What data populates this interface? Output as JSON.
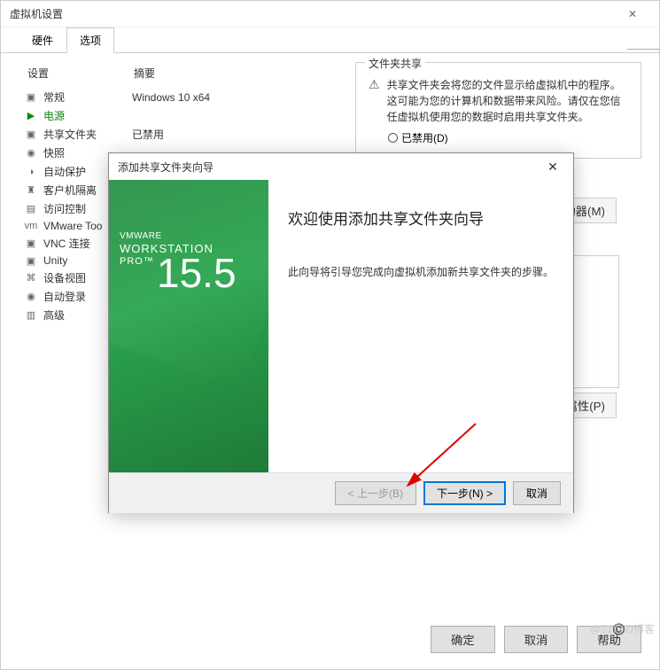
{
  "mainWindow": {
    "title": "虚拟机设置",
    "tabs": {
      "hardware": "硬件",
      "options": "选项"
    },
    "headers": {
      "setting": "设置",
      "summary": "摘要"
    },
    "rows": [
      {
        "icon": "▣",
        "label": "常规",
        "value": "Windows 10 x64"
      },
      {
        "icon": "▶",
        "label": "电源",
        "value": "",
        "green": true
      },
      {
        "icon": "▣",
        "label": "共享文件夹",
        "value": "已禁用"
      },
      {
        "icon": "◉",
        "label": "快照",
        "value": ""
      },
      {
        "icon": "◑",
        "label": "自动保护",
        "value": ""
      },
      {
        "icon": "♜",
        "label": "客户机隔离",
        "value": ""
      },
      {
        "icon": "▤",
        "label": "访问控制",
        "value": ""
      },
      {
        "icon": "vm",
        "label": "VMware Too",
        "value": ""
      },
      {
        "icon": "▣",
        "label": "VNC 连接",
        "value": ""
      },
      {
        "icon": "▣",
        "label": "Unity",
        "value": ""
      },
      {
        "icon": "⌘",
        "label": "设备视图",
        "value": ""
      },
      {
        "icon": "◉",
        "label": "自动登录",
        "value": ""
      },
      {
        "icon": "▥",
        "label": "高级",
        "value": ""
      }
    ],
    "group": {
      "title": "文件夹共享",
      "info": "共享文件夹会将您的文件显示给虚拟机中的程序。这可能为您的计算机和数据带来风险。请仅在您信任虚拟机使用您的数据时启用共享文件夹。",
      "radioDisabled": "已禁用(D)"
    },
    "sideButtons": {
      "addDrv": "动器(M)",
      "props": "属性(P)"
    },
    "buttons": {
      "ok": "确定",
      "cancel": "取消",
      "help": "帮助"
    }
  },
  "wizard": {
    "title": "添加共享文件夹向导",
    "brandSmall": "VMWARE",
    "brandName": "WORKSTATION",
    "brandPro": "PRO™",
    "version": "15.5",
    "heading": "欢迎使用添加共享文件夹向导",
    "body": "此向导将引导您完成向虚拟机添加新共享文件夹的步骤。",
    "buttons": {
      "back": "< 上一步(B)",
      "next": "下一步(N) >",
      "cancel": "取消"
    }
  },
  "watermark": "@51©️D博客"
}
